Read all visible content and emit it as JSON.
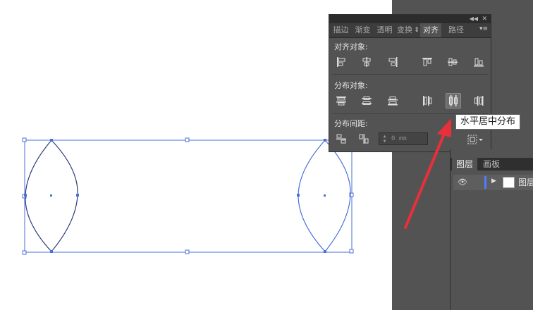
{
  "colors": {
    "selection": "#4a6fd9",
    "path": "#2b3a78",
    "arrow": "#e8303a",
    "panel_bg": "#535353",
    "panel_dark": "#2c2c2c",
    "active_layer_bar": "#4b7dff"
  },
  "align_panel": {
    "tabs": [
      {
        "label": "描边"
      },
      {
        "label": "渐变"
      },
      {
        "label": "透明"
      },
      {
        "label": "变换"
      },
      {
        "label": "对齐"
      },
      {
        "label": "路径"
      }
    ],
    "selected_tab": "对齐",
    "sections": {
      "align_objects": "对齐对象:",
      "distribute_objects": "分布对象:",
      "distribute_spacing": "分布间距:"
    },
    "spacing_value": "0 mm",
    "icons": {
      "align_row": [
        "align-left-icon",
        "align-horizontal-center-icon",
        "align-right-icon",
        "align-top-icon",
        "align-vertical-center-icon",
        "align-bottom-icon"
      ],
      "distribute_row": [
        "distribute-top-icon",
        "distribute-vertical-center-icon",
        "distribute-bottom-icon",
        "distribute-left-icon",
        "distribute-horizontal-center-icon",
        "distribute-right-icon"
      ],
      "spacing_row": [
        "distribute-vertical-space-icon",
        "distribute-horizontal-space-icon"
      ],
      "align_to": "align-to-selection-icon"
    },
    "active_button": "distribute-horizontal-center-icon"
  },
  "tooltip": {
    "text": "水平居中分布"
  },
  "layers_panel": {
    "tabs": [
      {
        "label": "图层"
      },
      {
        "label": "画板"
      }
    ],
    "selected_tab": "图层",
    "layer_name": "图层"
  }
}
